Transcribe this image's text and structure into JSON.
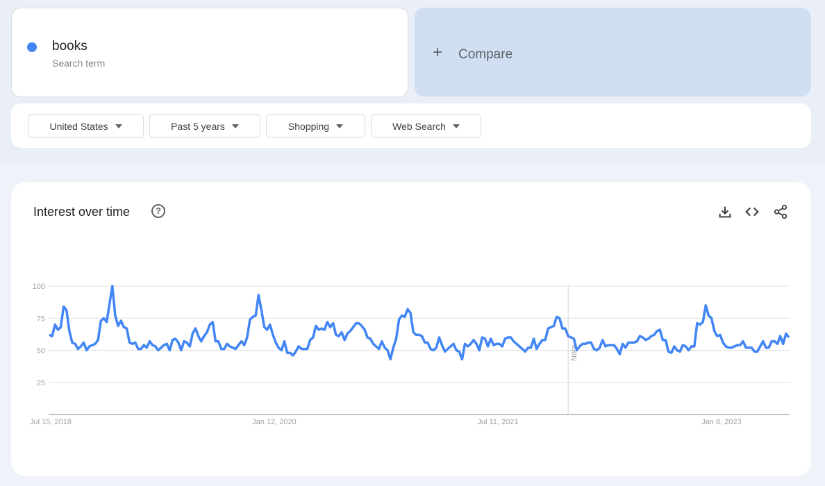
{
  "search_term": {
    "name": "books",
    "subtitle": "Search term",
    "color": "#4285f4"
  },
  "compare": {
    "icon": "plus-icon",
    "label": "Compare"
  },
  "filters": [
    {
      "label": "United States"
    },
    {
      "label": "Past 5 years"
    },
    {
      "label": "Shopping"
    },
    {
      "label": "Web Search"
    }
  ],
  "chart_card": {
    "title": "Interest over time",
    "help_icon": "?",
    "actions": [
      "download-icon",
      "embed-code-icon",
      "share-icon"
    ]
  },
  "chart_data": {
    "type": "line",
    "title": "Interest over time",
    "xlabel": "",
    "ylabel": "",
    "ylim": [
      0,
      100
    ],
    "yticks": [
      25,
      50,
      75,
      100
    ],
    "grid": true,
    "x_tick_labels": [
      "Jul 15, 2018",
      "Jan 12, 2020",
      "Jul 11, 2021",
      "Jan 8, 2023"
    ],
    "x_tick_positions": [
      0,
      78,
      156,
      234
    ],
    "annotation": {
      "label": "Note",
      "index": 181
    },
    "series": [
      {
        "name": "books",
        "color": "#4285f4",
        "values": [
          62,
          61,
          70,
          66,
          68,
          84,
          81,
          65,
          56,
          55,
          51,
          53,
          56,
          50,
          53,
          54,
          55,
          58,
          73,
          75,
          72,
          86,
          100,
          77,
          69,
          73,
          68,
          67,
          56,
          55,
          56,
          51,
          51,
          54,
          52,
          57,
          54,
          53,
          50,
          52,
          54,
          55,
          50,
          58,
          59,
          56,
          50,
          57,
          56,
          53,
          63,
          67,
          61,
          57,
          61,
          64,
          70,
          72,
          57,
          57,
          51,
          51,
          55,
          53,
          52,
          51,
          54,
          57,
          54,
          60,
          74,
          76,
          77,
          93,
          81,
          68,
          66,
          70,
          62,
          56,
          52,
          50,
          57,
          48,
          48,
          46,
          49,
          53,
          51,
          51,
          51,
          58,
          60,
          69,
          66,
          67,
          66,
          72,
          68,
          71,
          62,
          61,
          64,
          58,
          63,
          65,
          68,
          71,
          71,
          69,
          66,
          60,
          59,
          55,
          53,
          51,
          57,
          52,
          50,
          43,
          52,
          59,
          74,
          77,
          76,
          82,
          79,
          64,
          62,
          62,
          61,
          56,
          56,
          51,
          50,
          52,
          60,
          54,
          49,
          51,
          53,
          55,
          50,
          49,
          43,
          55,
          53,
          55,
          58,
          55,
          50,
          60,
          59,
          53,
          59,
          54,
          55,
          55,
          53,
          59,
          60,
          60,
          57,
          55,
          53,
          51,
          49,
          52,
          52,
          59,
          51,
          55,
          58,
          58,
          67,
          68,
          69,
          76,
          75,
          67,
          67,
          61,
          60,
          59,
          50,
          53,
          55,
          55,
          56,
          56,
          51,
          50,
          52,
          58,
          53,
          54,
          54,
          54,
          51,
          47,
          55,
          52,
          56,
          56,
          56,
          57,
          61,
          60,
          58,
          59,
          61,
          62,
          65,
          66,
          58,
          58,
          49,
          48,
          53,
          50,
          49,
          54,
          53,
          50,
          53,
          53,
          71,
          70,
          72,
          85,
          77,
          75,
          65,
          61,
          62,
          56,
          53,
          52,
          52,
          53,
          54,
          54,
          57,
          52,
          52,
          52,
          49,
          49,
          53,
          57,
          52,
          52,
          57,
          57,
          55,
          61,
          55,
          63,
          60
        ]
      }
    ]
  }
}
